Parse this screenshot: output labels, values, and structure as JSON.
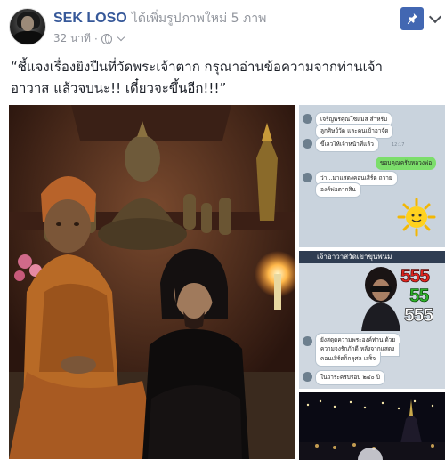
{
  "post": {
    "author": "SEK LOSO",
    "action": "ได้เพิ่มรูปภาพใหม่ 5 ภาพ",
    "time": "32 นาที",
    "privacy_icon": "globe-icon",
    "text_line1": "“ชี้แจงเรื่องยิงปืนที่วัดพระเจ้าตาก กรุณาอ่านข้อความจากท่านเจ้า",
    "text_line2": "อาวาส แล้วจบนะ!! เดี๋ยวจะขึ้นอีก!!!”"
  },
  "toolbar": {
    "pin_icon": "pin-icon",
    "more_icon": "chevron-down-icon"
  },
  "colors": {
    "facebook_blue": "#4267b2",
    "link_blue": "#365899",
    "meta_gray": "#90949c",
    "line_green": "#7cde6b"
  },
  "chat1": {
    "messages": [
      {
        "text": "เจริญพรคุณโซ่แมส สำหรับ",
        "dir": "in"
      },
      {
        "text": "ลูกศิษย์วัด และคนเข้าอาจัด",
        "dir": "in"
      },
      {
        "text": "ขี้เลวให้เจ้าหน้าที่แล้ว",
        "dir": "in"
      },
      {
        "text": "ขอบคุณครับหลวงพ่อ",
        "dir": "out"
      },
      {
        "text": "ว่า...มาแสดงคอนเสิร์ต ถวาย",
        "dir": "in"
      },
      {
        "text": "องค์พ่อตากสิน",
        "dir": "in"
      }
    ],
    "time": "12:17",
    "sticker_icon": "sun-icon"
  },
  "chat2": {
    "header": "เจ้าอาวาสวัดเขาขุนพนม",
    "sticker_text": [
      "555",
      "55",
      "555"
    ],
    "messages": [
      {
        "text": "ยังสดุดความพระองค์ท่าน ด้วย",
        "dir": "in"
      },
      {
        "text": "ความจงรักภักดี หลังจากแสดง",
        "dir": "in"
      },
      {
        "text": "คอนเสิร์ตก็กลุศล เสร็จ",
        "dir": "in"
      },
      {
        "text": "ในวาระครบรอบ ๒๔๐ ปี",
        "dir": "in"
      }
    ]
  }
}
